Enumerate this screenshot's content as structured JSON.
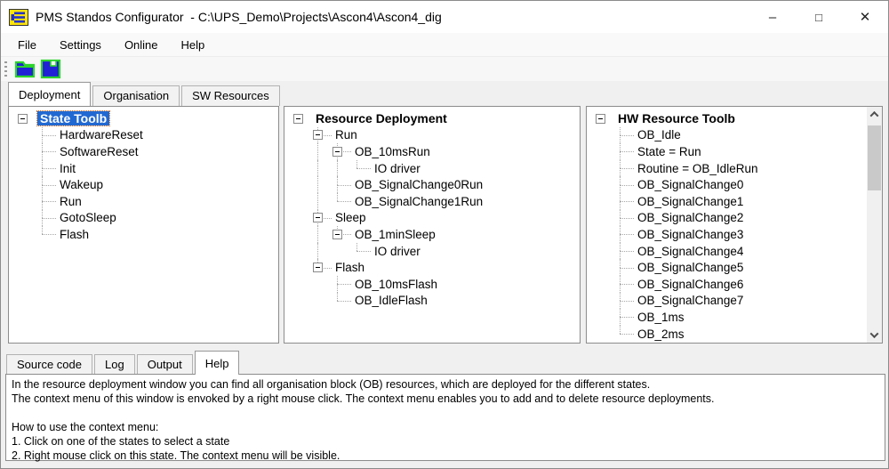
{
  "window": {
    "title": "PMS Standos Configurator  - C:\\UPS_Demo\\Projects\\Ascon4\\Ascon4_dig",
    "controls": {
      "minimize": "–",
      "maximize": "□",
      "close": "✕"
    }
  },
  "menu": {
    "items": [
      "File",
      "Settings",
      "Online",
      "Help"
    ]
  },
  "toolbar": {
    "buttons": [
      "open-project",
      "save-project"
    ]
  },
  "top_tabs": {
    "items": [
      "Deployment",
      "Organisation",
      "SW Resources"
    ],
    "active": "Deployment"
  },
  "trees": {
    "state_toolbox": {
      "rows": [
        {
          "level": 0,
          "label": "State Toolb",
          "bold": true,
          "selected": true,
          "expander": true
        },
        {
          "level": 1,
          "label": "HardwareReset"
        },
        {
          "level": 1,
          "label": "SoftwareReset"
        },
        {
          "level": 1,
          "label": "Init"
        },
        {
          "level": 1,
          "label": "Wakeup"
        },
        {
          "level": 1,
          "label": "Run"
        },
        {
          "level": 1,
          "label": "GotoSleep"
        },
        {
          "level": 1,
          "label": "Flash"
        }
      ]
    },
    "resource_deployment": {
      "rows": [
        {
          "level": 0,
          "label": "Resource Deployment",
          "bold": true,
          "expander": true
        },
        {
          "level": 1,
          "label": "Run",
          "expander": true
        },
        {
          "level": 2,
          "label": "OB_10msRun",
          "expander": true
        },
        {
          "level": 3,
          "label": "IO driver"
        },
        {
          "level": 2,
          "label": "OB_SignalChange0Run"
        },
        {
          "level": 2,
          "label": "OB_SignalChange1Run"
        },
        {
          "level": 1,
          "label": "Sleep",
          "expander": true
        },
        {
          "level": 2,
          "label": "OB_1minSleep",
          "expander": true
        },
        {
          "level": 3,
          "label": "IO driver"
        },
        {
          "level": 1,
          "label": "Flash",
          "expander": true
        },
        {
          "level": 2,
          "label": "OB_10msFlash"
        },
        {
          "level": 2,
          "label": "OB_IdleFlash"
        }
      ]
    },
    "hw_resource_toolbox": {
      "rows": [
        {
          "level": 0,
          "label": "HW Resource Toolb",
          "bold": true,
          "expander": true
        },
        {
          "level": 1,
          "label": "OB_Idle"
        },
        {
          "level": 1,
          "label": "State = Run"
        },
        {
          "level": 1,
          "label": "Routine = OB_IdleRun"
        },
        {
          "level": 1,
          "label": "OB_SignalChange0"
        },
        {
          "level": 1,
          "label": "OB_SignalChange1"
        },
        {
          "level": 1,
          "label": "OB_SignalChange2"
        },
        {
          "level": 1,
          "label": "OB_SignalChange3"
        },
        {
          "level": 1,
          "label": "OB_SignalChange4"
        },
        {
          "level": 1,
          "label": "OB_SignalChange5"
        },
        {
          "level": 1,
          "label": "OB_SignalChange6"
        },
        {
          "level": 1,
          "label": "OB_SignalChange7"
        },
        {
          "level": 1,
          "label": "OB_1ms"
        },
        {
          "level": 1,
          "label": "OB_2ms"
        }
      ]
    }
  },
  "bottom_tabs": {
    "items": [
      "Source code",
      "Log",
      "Output",
      "Help"
    ],
    "active": "Help"
  },
  "help": {
    "lines": [
      "In the resource deployment window you can find all organisation block (OB) resources, which are deployed for the different states.",
      "The context menu of this window is envoked by a right mouse click. The context menu enables you to add and to delete resource deployments.",
      "",
      "How to use the context menu:",
      "1. Click on one of the states to select a state",
      "2. Right mouse click on this state. The context menu will be visible."
    ]
  },
  "colors": {
    "selection_blue": "#2169d2",
    "focus_dotted": "#cf6a1b",
    "icon_green": "#2bd42b",
    "icon_blue": "#2121d6",
    "app_icon_yellow": "#ffe40a",
    "app_icon_blue": "#2233cc"
  }
}
